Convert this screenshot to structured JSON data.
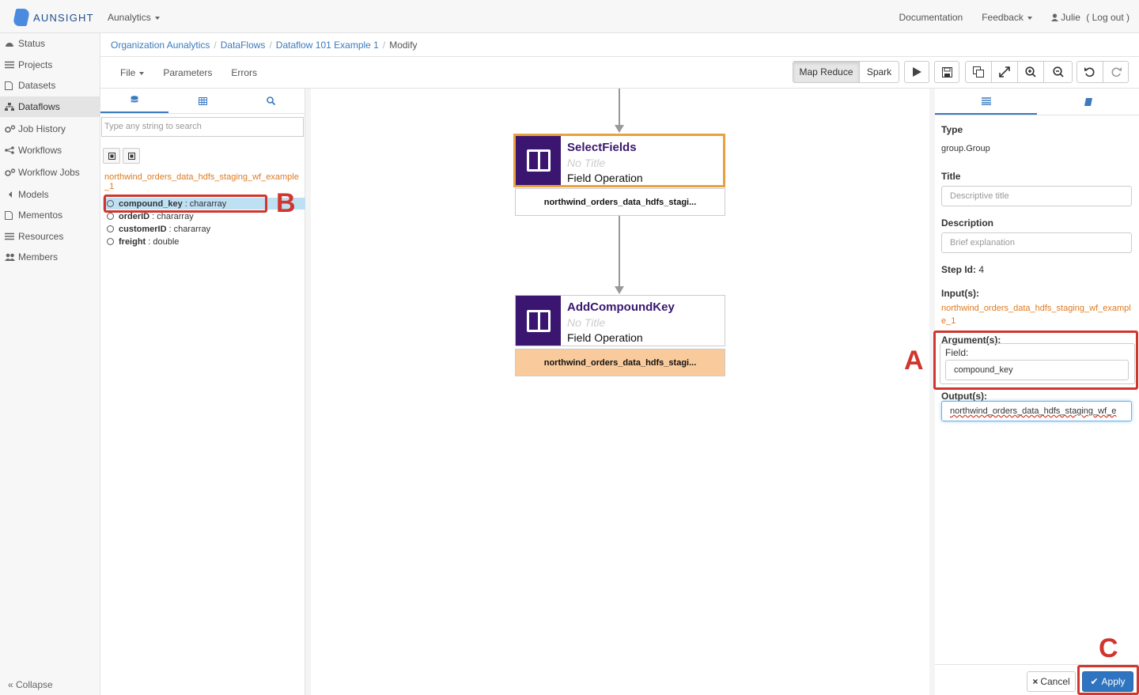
{
  "app": {
    "brand": "AUNSIGHT",
    "org_menu": "Aunalytics",
    "documentation": "Documentation",
    "feedback": "Feedback",
    "user": "Julie",
    "logout": "( Log out )"
  },
  "sidebar": {
    "items": [
      {
        "label": "Status",
        "icon": "dashboard-icon"
      },
      {
        "label": "Projects",
        "icon": "list-icon"
      },
      {
        "label": "Datasets",
        "icon": "file-icon"
      },
      {
        "label": "Dataflows",
        "icon": "sitemap-icon",
        "active": true
      },
      {
        "label": "Job History",
        "icon": "cogs-icon"
      },
      {
        "label": "Workflows",
        "icon": "workflow-icon"
      },
      {
        "label": "Workflow Jobs",
        "icon": "cogs-icon"
      },
      {
        "label": "Models",
        "icon": "model-icon"
      },
      {
        "label": "Mementos",
        "icon": "file-icon"
      },
      {
        "label": "Resources",
        "icon": "list-icon"
      },
      {
        "label": "Members",
        "icon": "users-icon"
      }
    ],
    "collapse": "« Collapse"
  },
  "breadcrumb": {
    "items": [
      "Organization Aunalytics",
      "DataFlows",
      "Dataflow 101 Example 1"
    ],
    "current": "Modify"
  },
  "toolbar": {
    "file": "File",
    "parameters": "Parameters",
    "errors": "Errors",
    "map_reduce": "Map Reduce",
    "spark": "Spark"
  },
  "left_panel": {
    "search_placeholder": "Type any string to search",
    "dataset_name": "northwind_orders_data_hdfs_staging_wf_example_1",
    "fields": [
      {
        "name": "compound_key",
        "type": ": chararray"
      },
      {
        "name": "orderID",
        "type": ": chararray"
      },
      {
        "name": "customerID",
        "type": ": chararray"
      },
      {
        "name": "freight",
        "type": ": double"
      }
    ]
  },
  "canvas": {
    "nodes": [
      {
        "title": "SelectFields",
        "subtitle": "No Title",
        "type": "Field Operation",
        "output": "northwind_orders_data_hdfs_stagi..."
      },
      {
        "title": "AddCompoundKey",
        "subtitle": "No Title",
        "type": "Field Operation",
        "output": "northwind_orders_data_hdfs_stagi..."
      }
    ]
  },
  "right_panel": {
    "type_label": "Type",
    "type_value": "group.Group",
    "title_label": "Title",
    "title_placeholder": "Descriptive title",
    "description_label": "Description",
    "description_placeholder": "Brief explanation",
    "step_id_label": "Step Id:",
    "step_id_value": "4",
    "inputs_label": "Input(s):",
    "inputs_value": "northwind_orders_data_hdfs_staging_wf_example_1",
    "arguments_label": "Argument(s):",
    "field_label": "Field:",
    "field_value": "compound_key",
    "outputs_label": "Output(s):",
    "outputs_value": "northwind_orders_data_hdfs_staging_wf_e",
    "cancel": "Cancel",
    "apply": "Apply"
  },
  "annotations": {
    "a": "A",
    "b": "B",
    "c": "C"
  },
  "colors": {
    "accent": "#3a7abf",
    "node": "#3a1670",
    "selected_border": "#e8a13f",
    "annotation": "#d0362d",
    "highlight_output": "#f9ca9c",
    "dataset": "#e07a1f"
  }
}
